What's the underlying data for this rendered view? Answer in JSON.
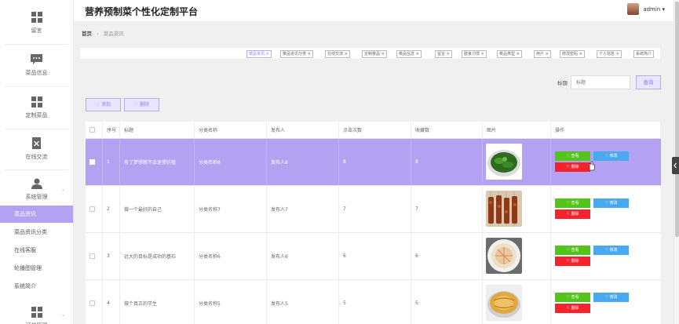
{
  "app": {
    "title": "营养预制菜个性化定制平台",
    "user": "admin ▾"
  },
  "sidebar": {
    "items": [
      {
        "label": "留言",
        "icon": "grid-icon"
      },
      {
        "label": "菜品信息",
        "icon": "chat-icon"
      },
      {
        "label": "定制菜品",
        "icon": "grid-icon"
      },
      {
        "label": "在线交流",
        "icon": "document-icon"
      },
      {
        "label": "系统管理",
        "icon": "user-icon",
        "expanded": true
      }
    ],
    "subitems": [
      "菜品资讯",
      "菜品资讯分类",
      "在线客服",
      "轮播图管理",
      "系统简介"
    ],
    "active": "菜品资讯",
    "bottom_item": {
      "label": "订单管理",
      "icon": "grid-icon"
    }
  },
  "breadcrumb": {
    "home": "首页",
    "sep": "›",
    "current": "菜品资讯"
  },
  "tags": [
    "菜品资讯 ×",
    "菜品资讯分类 ×",
    "在线交流 ×",
    "定制菜品 ×",
    "菜品信息 ×",
    "留言 ×",
    "膳食习惯 ×",
    "菜品类型 ×",
    "用户 ×",
    "修改密码 ×",
    "个人信息 ×",
    "系统简介"
  ],
  "active_tag": "菜品资讯 ×",
  "search": {
    "label": "标题",
    "placeholder": "标题",
    "button": "查询"
  },
  "toolbar": {
    "add": "♡ 添加",
    "delete": "♡ 删除"
  },
  "table": {
    "headers": [
      "",
      "序号",
      "标题",
      "分类名称",
      "发布人",
      "点击次数",
      "收藏数",
      "图片",
      "操作"
    ],
    "rows": [
      {
        "no": "1",
        "title": "有了梦想就不会迷惘彷徨",
        "category": "分类名称8",
        "publisher": "发布人8",
        "clicks": "8",
        "favs": "8",
        "img": "greens",
        "selected": true
      },
      {
        "no": "2",
        "title": "做一个最好的自己",
        "category": "分类名称7",
        "publisher": "发布人7",
        "clicks": "7",
        "favs": "7",
        "img": "skewers",
        "selected": false
      },
      {
        "no": "3",
        "title": "远大的目标是成功的基石",
        "category": "分类名称6",
        "publisher": "发布人6",
        "clicks": "6",
        "favs": "6",
        "img": "porridge",
        "selected": false
      },
      {
        "no": "4",
        "title": "做个真正的学生",
        "category": "分类名称5",
        "publisher": "发布人5",
        "clicks": "5",
        "favs": "5",
        "img": "pancake",
        "selected": false
      }
    ],
    "actions": {
      "view": "♡ 查看",
      "edit": "♡ 修改",
      "delete": "♡ 删除"
    }
  },
  "colors": {
    "accent": "#b3a2f1",
    "view": "#52c41a",
    "edit": "#49a9ee",
    "delete": "#f5222d"
  }
}
